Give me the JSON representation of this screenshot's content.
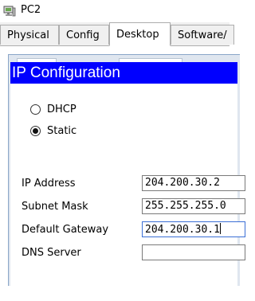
{
  "window": {
    "title": "PC2",
    "icon": "pc-device-icon"
  },
  "tabs": [
    {
      "label": "Physical",
      "active": false
    },
    {
      "label": "Config",
      "active": false
    },
    {
      "label": "Desktop",
      "active": true
    },
    {
      "label": "Software/",
      "active": false
    }
  ],
  "ip_config": {
    "header": "IP Configuration",
    "mode_options": [
      {
        "label": "DHCP",
        "selected": false
      },
      {
        "label": "Static",
        "selected": true
      }
    ],
    "fields": [
      {
        "label": "IP Address",
        "value": "204.200.30.2",
        "focused": false
      },
      {
        "label": "Subnet Mask",
        "value": "255.255.255.0",
        "focused": false
      },
      {
        "label": "Default Gateway",
        "value": "204.200.30.1",
        "focused": true
      },
      {
        "label": "DNS Server",
        "value": "",
        "focused": false
      }
    ]
  },
  "colors": {
    "header_bg": "#0000ff",
    "header_text": "#ffffff",
    "tabbar_bg": "#f0f0f0"
  }
}
